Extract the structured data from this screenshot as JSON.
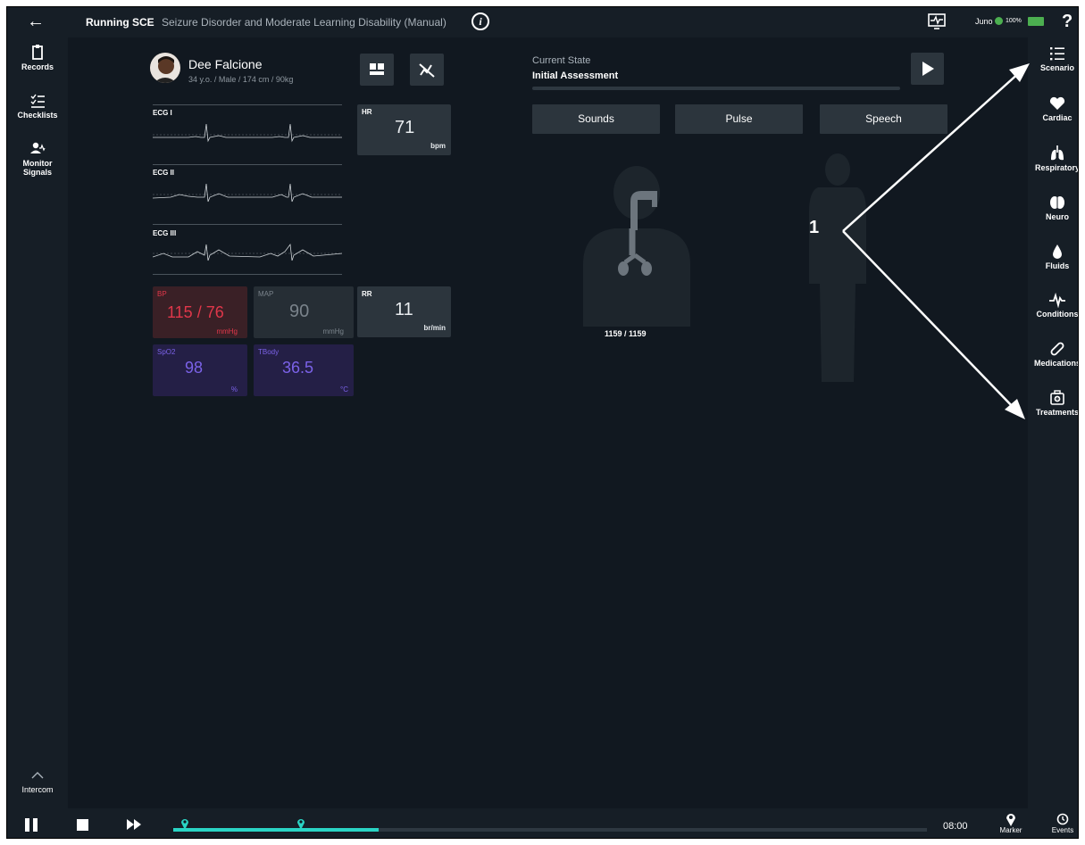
{
  "topbar": {
    "running_label": "Running SCE",
    "scenario_title": "Seizure Disorder and Moderate Learning Disability (Manual)",
    "info_glyph": "i",
    "device_name": "Juno",
    "battery_pct": "100%",
    "help_glyph": "?",
    "back_glyph": "←"
  },
  "left_nav": {
    "records": "Records",
    "checklists": "Checklists",
    "monitor_signals": "Monitor Signals",
    "intercom": "Intercom"
  },
  "right_nav": {
    "scenario": "Scenario",
    "cardiac": "Cardiac",
    "respiratory": "Respiratory",
    "neuro": "Neuro",
    "fluids": "Fluids",
    "conditions": "Conditions",
    "medications": "Medications",
    "treatments": "Treatments"
  },
  "patient": {
    "name": "Dee Falcione",
    "info": "34 y.o. / Male / 174 cm / 90kg"
  },
  "ecg": {
    "lead1": "ECG I",
    "lead2": "ECG II",
    "lead3": "ECG III"
  },
  "vitals": {
    "hr": {
      "label": "HR",
      "value": "71",
      "unit": "bpm"
    },
    "bp": {
      "label": "BP",
      "value": "115 / 76",
      "unit": "mmHg"
    },
    "map": {
      "label": "MAP",
      "value": "90",
      "unit": "mmHg"
    },
    "rr": {
      "label": "RR",
      "value": "11",
      "unit": "br/min"
    },
    "spo2": {
      "label": "SpO2",
      "value": "98",
      "unit": "%"
    },
    "tbody": {
      "label": "TBody",
      "value": "36.5",
      "unit": "°C"
    }
  },
  "state": {
    "label": "Current State",
    "value": "Initial Assessment"
  },
  "tabs": {
    "sounds": "Sounds",
    "pulse": "Pulse",
    "speech": "Speech"
  },
  "airway_counter": "1159 / 1159",
  "timeline": {
    "time": "08:00",
    "marker": "Marker",
    "events": "Events"
  },
  "annotation": {
    "callout": "1"
  },
  "colors": {
    "background": "#111820",
    "panel": "#2c353d",
    "bp_red": "#e0374a",
    "spo2_purple": "#7b62e8",
    "accent_teal": "#2ad4c4",
    "status_green": "#4caf50"
  }
}
